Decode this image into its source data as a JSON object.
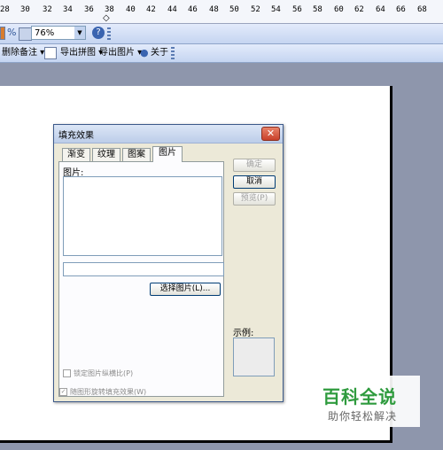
{
  "ruler": {
    "ticks": [
      "28",
      "30",
      "32",
      "34",
      "36",
      "38",
      "40",
      "42",
      "44",
      "46",
      "48",
      "50",
      "52",
      "54",
      "56",
      "58",
      "60",
      "62",
      "64",
      "66",
      "68"
    ]
  },
  "toolbar1": {
    "zoom_value": "76%",
    "zoom_options": [
      "76%"
    ]
  },
  "toolbar2": {
    "delete_note": "删除备注 ▾",
    "export_combined": "导出拼图 ▾",
    "export_image": "导出图片 ▾",
    "about": "关于"
  },
  "dialog": {
    "title": "填充效果",
    "close_label": "✕",
    "tabs": [
      "渐变",
      "纹理",
      "图案",
      "图片"
    ],
    "active_tab": "图片",
    "picture_label": "图片:",
    "select_picture_button": "选择图片(L)...",
    "lock_aspect_checkbox": "锁定图片纵横比(P)",
    "rotate_fill_checkbox": "随图形旋转填充效果(W)",
    "ok_button": "确定",
    "cancel_button": "取消",
    "preview_button": "预览(P)",
    "sample_label": "示例:"
  },
  "watermark": {
    "title": "百科全说",
    "subtitle": "助你轻松解决"
  },
  "colors": {
    "accent": "#2f9b3e",
    "canvas": "#8e96ac",
    "dialog_bg": "#ece9d8"
  }
}
